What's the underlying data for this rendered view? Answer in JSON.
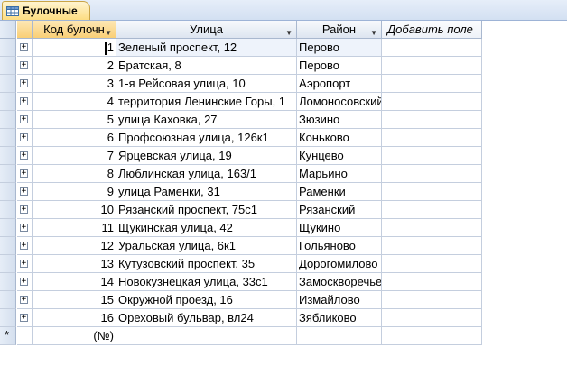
{
  "tab": {
    "title": "Булочные",
    "icon": "table-icon"
  },
  "columns": {
    "id": "Код булочн",
    "street": "Улица",
    "district": "Район",
    "add": "Добавить поле"
  },
  "rows": [
    {
      "id": "1",
      "street": "Зеленый проспект, 12",
      "district": "Перово"
    },
    {
      "id": "2",
      "street": "Братская, 8",
      "district": "Перово"
    },
    {
      "id": "3",
      "street": "1-я Рейсовая улица, 10",
      "district": "Аэропорт"
    },
    {
      "id": "4",
      "street": "территория Ленинские Горы, 1",
      "district": "Ломоносовский"
    },
    {
      "id": "5",
      "street": "улица Каховка, 27",
      "district": "Зюзино"
    },
    {
      "id": "6",
      "street": "Профсоюзная улица, 126к1",
      "district": "Коньково"
    },
    {
      "id": "7",
      "street": "Ярцевская улица, 19",
      "district": "Кунцево"
    },
    {
      "id": "8",
      "street": "Люблинская улица, 163/1",
      "district": "Марьино"
    },
    {
      "id": "9",
      "street": "улица Раменки, 31",
      "district": "Раменки"
    },
    {
      "id": "10",
      "street": "Рязанский проспект, 75с1",
      "district": "Рязанский"
    },
    {
      "id": "11",
      "street": "Щукинская улица, 42",
      "district": "Щукино"
    },
    {
      "id": "12",
      "street": "Уральская улица, 6к1",
      "district": "Гольяново"
    },
    {
      "id": "13",
      "street": "Кутузовский проспект, 35",
      "district": "Дорогомилово"
    },
    {
      "id": "14",
      "street": "Новокузнецкая улица, 33с1",
      "district": "Замоскворечье"
    },
    {
      "id": "15",
      "street": "Окружной проезд, 16",
      "district": "Измайлово"
    },
    {
      "id": "16",
      "street": "Ореховый бульвар, вл24",
      "district": "Зябликово"
    }
  ],
  "new_row": {
    "id_placeholder": "(№)",
    "marker": "*"
  },
  "expander_symbol": "+",
  "colors": {
    "header": "#dde5f0",
    "tab": "#fddd82",
    "gridline": "#c4cede"
  }
}
